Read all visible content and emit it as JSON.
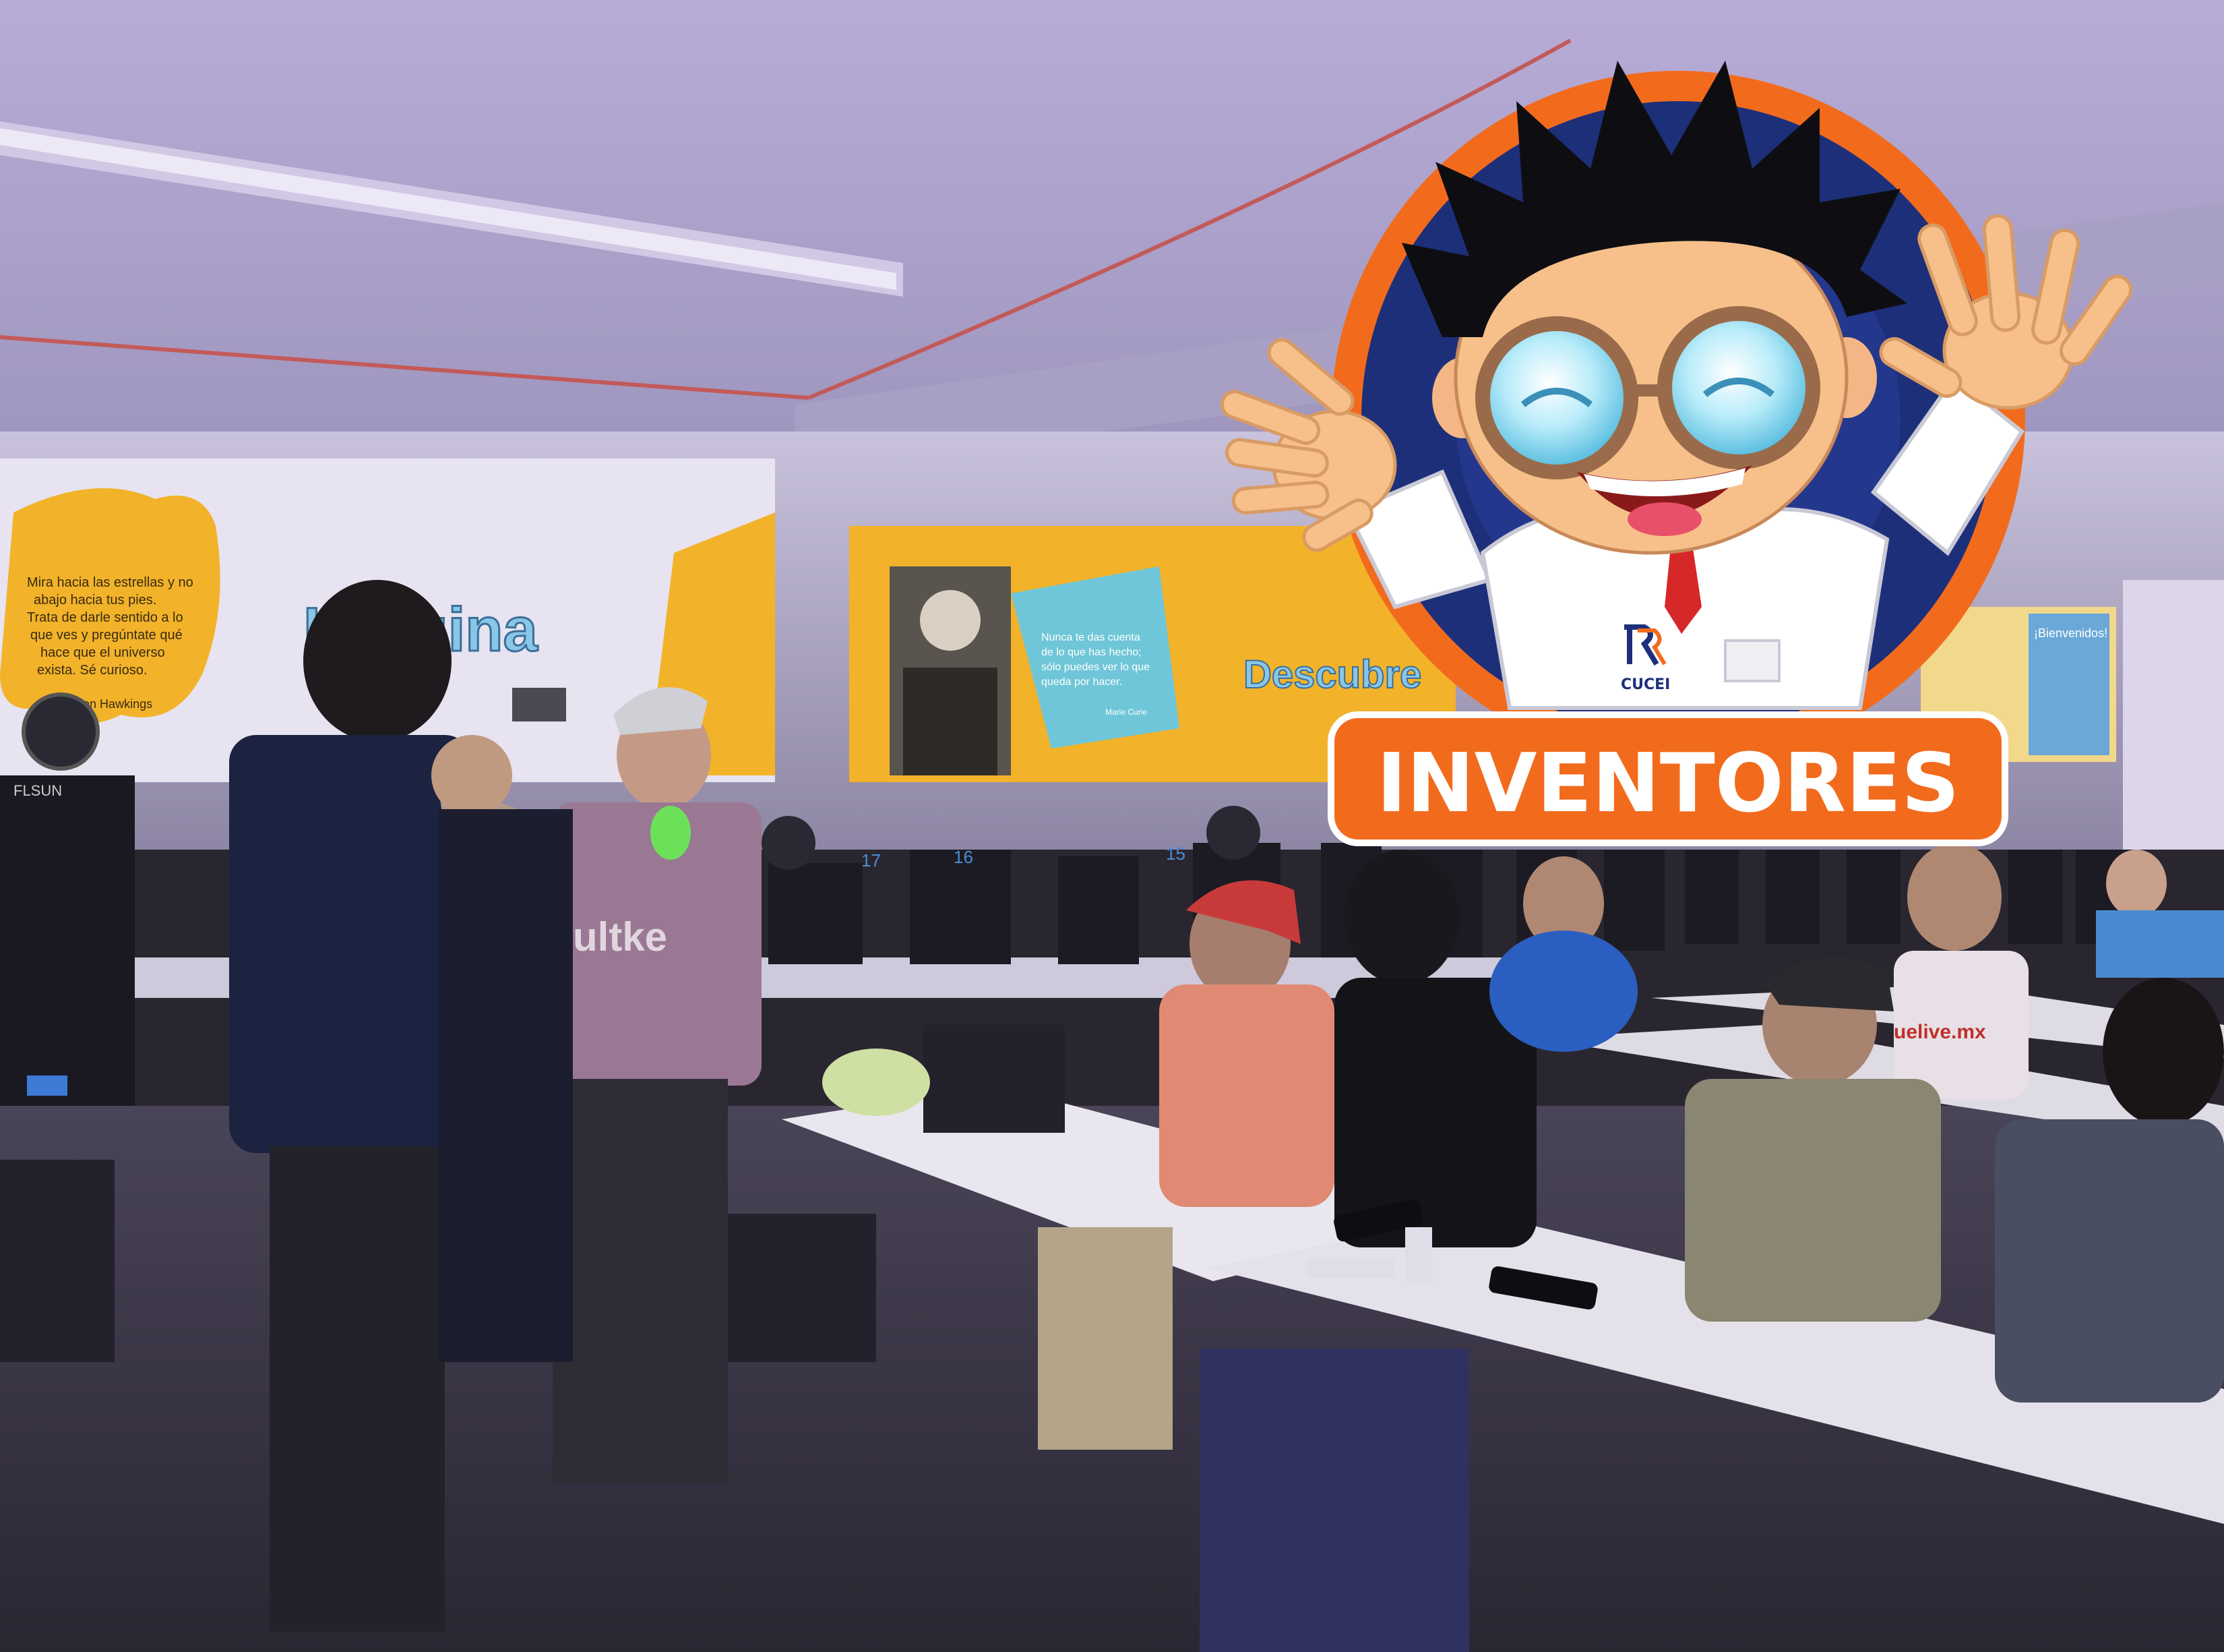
{
  "photo": {
    "banners": {
      "imagina": "Imagina",
      "descubre": "Descubre",
      "hawking_quote": [
        "Mira hacia las estrellas y no",
        "abajo hacia tus pies.",
        "Trata de darle sentido a lo",
        "que ves y pregúntate qué",
        "hace que el universo",
        "exista. Sé curioso."
      ],
      "hawking_author": "-Stephen Hawkings",
      "curie_quote": [
        "Nunca te das cuenta",
        "de lo que has hecho;",
        "sólo puedes ver lo que",
        "queda por hacer."
      ],
      "curie_author": "Marie Curie",
      "bienvenidos": "¡Bienvenidos!"
    },
    "printer_labels": [
      "17",
      "16",
      "15"
    ],
    "printer_brand": "FLSUN",
    "shirt_text": "uelive.mx"
  },
  "overlay": {
    "title": "INVENTORES",
    "logo_text": "CUCEI",
    "colors": {
      "orange": "#F26B1D",
      "navy": "#1E2F7A",
      "white": "#FFFFFF"
    }
  }
}
